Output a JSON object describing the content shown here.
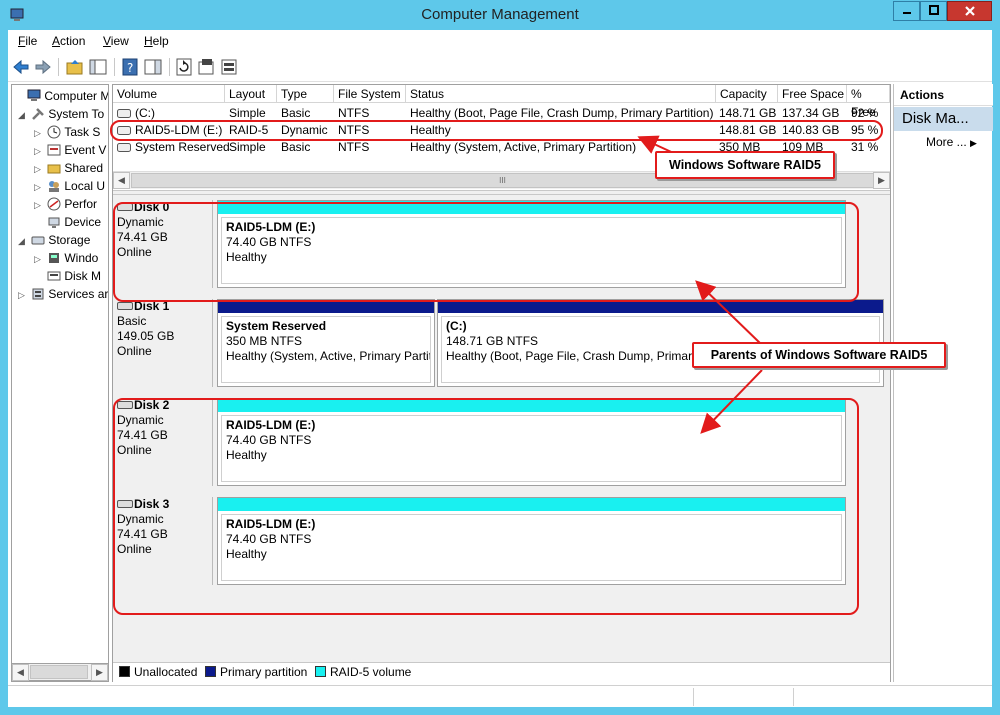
{
  "window": {
    "title": "Computer Management"
  },
  "menu": {
    "file": "File",
    "file_key": "F",
    "file_rest": "ile",
    "action_key": "A",
    "action_rest": "ction",
    "view_key": "V",
    "view_rest": "iew",
    "help_key": "H",
    "help_rest": "elp"
  },
  "tree": {
    "items": [
      {
        "label": "Computer Ma",
        "icon": "computer-icon"
      },
      {
        "label": "System To",
        "icon": "tools-icon"
      },
      {
        "label": "Task S",
        "icon": "clock-icon"
      },
      {
        "label": "Event V",
        "icon": "event-viewer-icon"
      },
      {
        "label": "Shared",
        "icon": "shared-folder-icon"
      },
      {
        "label": "Local U",
        "icon": "users-icon"
      },
      {
        "label": "Perfor",
        "icon": "performance-icon"
      },
      {
        "label": "Device",
        "icon": "device-icon"
      },
      {
        "label": "Storage",
        "icon": "storage-icon"
      },
      {
        "label": "Windo",
        "icon": "backup-icon"
      },
      {
        "label": "Disk M",
        "icon": "disk-icon"
      },
      {
        "label": "Services ar",
        "icon": "services-icon"
      }
    ]
  },
  "volume_list": {
    "columns": [
      "Volume",
      "Layout",
      "Type",
      "File System",
      "Status",
      "Capacity",
      "Free Space",
      "% Free"
    ],
    "rows": [
      {
        "volume": "(C:)",
        "layout": "Simple",
        "type": "Basic",
        "fs": "NTFS",
        "status": "Healthy (Boot, Page File, Crash Dump, Primary Partition)",
        "capacity": "148.71 GB",
        "free": "137.34 GB",
        "pct": "92 %"
      },
      {
        "volume": "RAID5-LDM (E:)",
        "layout": "RAID-5",
        "type": "Dynamic",
        "fs": "NTFS",
        "status": "Healthy",
        "capacity": "148.81 GB",
        "free": "140.83 GB",
        "pct": "95 %"
      },
      {
        "volume": "System Reserved",
        "layout": "Simple",
        "type": "Basic",
        "fs": "NTFS",
        "status": "Healthy (System, Active, Primary Partition)",
        "capacity": "350 MB",
        "free": "109 MB",
        "pct": "31 %"
      }
    ],
    "scroll_thumb": "III"
  },
  "disks": [
    {
      "name": "Disk 0",
      "type": "Dynamic",
      "size": "74.41 GB",
      "state": "Online",
      "partitions": [
        {
          "name": "RAID5-LDM  (E:)",
          "size": "74.40 GB NTFS",
          "status": "Healthy"
        }
      ]
    },
    {
      "name": "Disk 1",
      "type": "Basic",
      "size": "149.05 GB",
      "state": "Online",
      "partitions": [
        {
          "name": "System Reserved",
          "size": "350 MB NTFS",
          "status": "Healthy (System, Active, Primary Partit"
        },
        {
          "name": "(C:)",
          "size": "148.71 GB NTFS",
          "status": "Healthy (Boot, Page File, Crash Dump, Primary"
        }
      ]
    },
    {
      "name": "Disk 2",
      "type": "Dynamic",
      "size": "74.41 GB",
      "state": "Online",
      "partitions": [
        {
          "name": "RAID5-LDM  (E:)",
          "size": "74.40 GB NTFS",
          "status": "Healthy"
        }
      ]
    },
    {
      "name": "Disk 3",
      "type": "Dynamic",
      "size": "74.41 GB",
      "state": "Online",
      "partitions": [
        {
          "name": "RAID5-LDM  (E:)",
          "size": "74.40 GB NTFS",
          "status": "Healthy"
        }
      ]
    }
  ],
  "legend": {
    "unallocated": "Unallocated",
    "primary": "Primary partition",
    "raid5": "RAID-5 volume",
    "colors": {
      "unallocated": "#000000",
      "primary": "#0b1a8c",
      "raid5": "#19f0f0"
    }
  },
  "actions": {
    "header": "Actions",
    "selected": "Disk Ma...",
    "more": "More ..."
  },
  "annotations": {
    "raid5_label": "Windows Software RAID5",
    "parents_label": "Parents of Windows Software RAID5",
    "color": "#e21b1b"
  }
}
